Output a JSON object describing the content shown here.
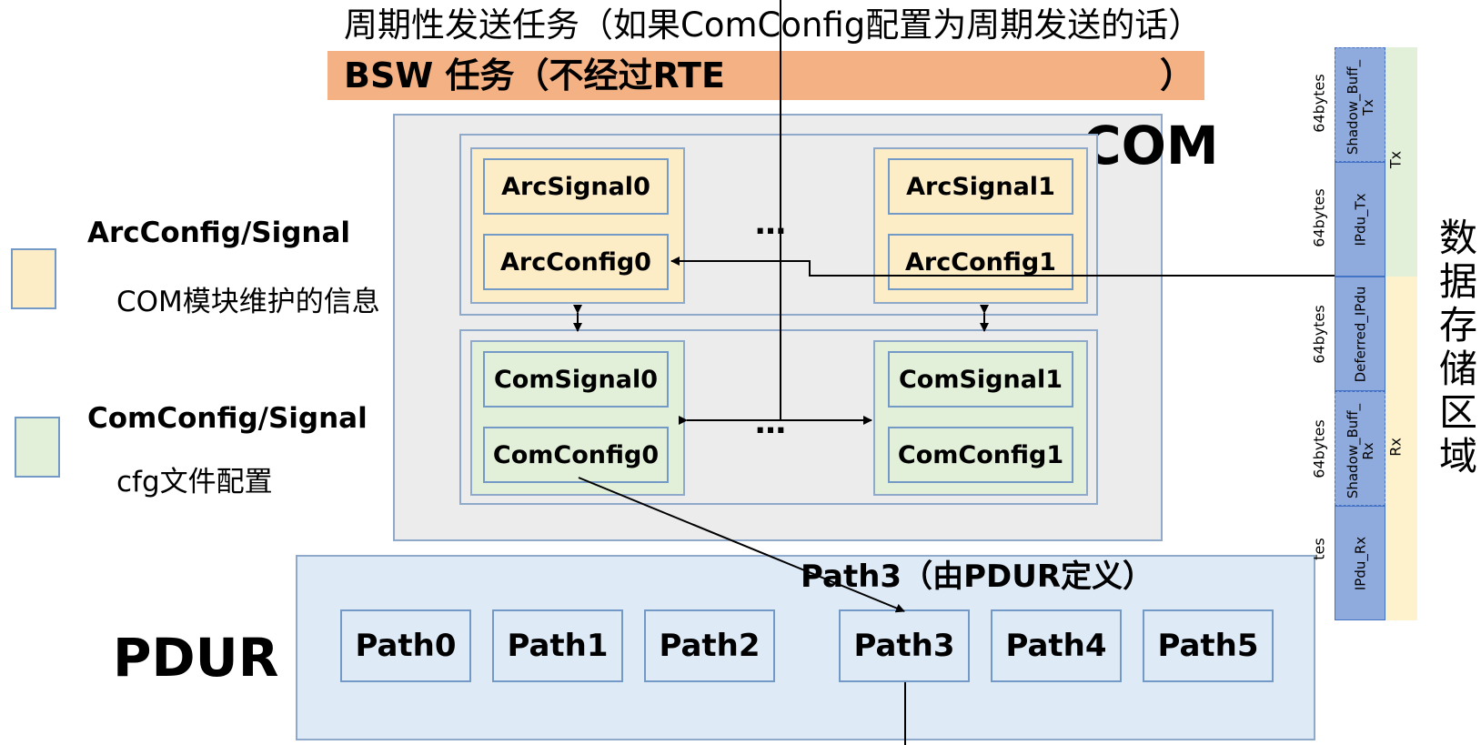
{
  "header": {
    "top_title": "周期性发送任务（如果ComConfig配置为周期发送的话）",
    "bsw_task": "BSW 任务（不经过RTE）",
    "bsw_task_prefix": "BSW 任务（不经过RTE",
    "bsw_task_suffix": "）"
  },
  "com": {
    "label": "COM",
    "group0": {
      "signal": "ArcSignal0",
      "config": "ArcConfig0"
    },
    "group1": {
      "signal": "ArcSignal1",
      "config": "ArcConfig1"
    },
    "group2": {
      "signal": "ComSignal0",
      "config": "ComConfig0"
    },
    "group3": {
      "signal": "ComSignal1",
      "config": "ComConfig1"
    },
    "ellipsis": "…"
  },
  "legend": {
    "arc": {
      "title": "ArcConfig/Signal",
      "desc": "COM模块维护的信息"
    },
    "com": {
      "title": "ComConfig/Signal",
      "desc": "cfg文件配置"
    }
  },
  "pdur": {
    "label": "PDUR",
    "paths": [
      "Path0",
      "Path1",
      "Path2",
      "Path3",
      "Path4",
      "Path5"
    ],
    "path3_caption": "Path3（由PDUR定义）"
  },
  "storage": {
    "title": "数据存储区域",
    "tx_label": "Tx",
    "rx_label": "Rx",
    "cells": [
      {
        "name": "Shadow_Buff_\nTx",
        "line1": "Shadow_Buff_",
        "line2": "Tx",
        "size": "64bytes"
      },
      {
        "name": "IPdu_Tx",
        "line1": "IPdu_Tx",
        "line2": "",
        "size": "64bytes"
      },
      {
        "name": "Deferred_IPdu",
        "line1": "Deferred_IPdu",
        "line2": "",
        "size": "64bytes"
      },
      {
        "name": "Shadow_Buff_\nRx",
        "line1": "Shadow_Buff_",
        "line2": "Rx",
        "size": "64bytes"
      },
      {
        "name": "IPdu_Rx",
        "line1": "IPdu_Rx",
        "line2": "",
        "size": "tes"
      }
    ]
  },
  "colors": {
    "bsw_bar": "#f4b183",
    "arc_fill": "#fdedc7",
    "com_fill": "#e2efd9",
    "pdur_fill": "#deebf7",
    "storage_cell": "#8faadc",
    "border": "#7399c6"
  }
}
